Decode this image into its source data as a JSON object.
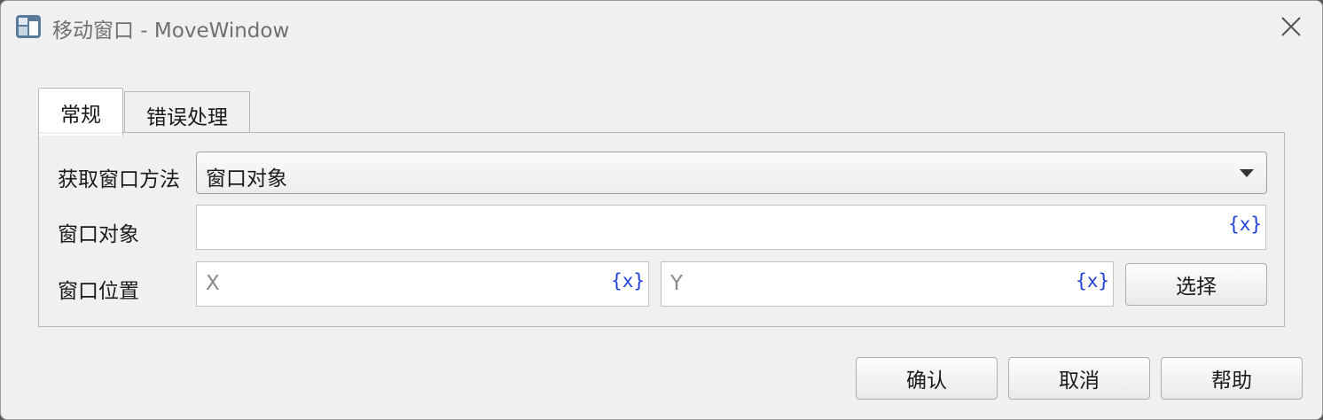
{
  "window": {
    "title": "移动窗口 - MoveWindow"
  },
  "tabs": [
    {
      "label": "常规",
      "active": true
    },
    {
      "label": "错误处理",
      "active": false
    }
  ],
  "form": {
    "method_label": "获取窗口方法",
    "method_value": "窗口对象",
    "object_label": "窗口对象",
    "object_value": "",
    "position_label": "窗口位置",
    "x_placeholder": "X",
    "y_placeholder": "Y",
    "var_token": "{x}",
    "pick_button": "选择"
  },
  "footer": {
    "ok": "确认",
    "cancel": "取消",
    "help": "帮助"
  },
  "icons": {
    "app": "app-icon",
    "close": "close-icon",
    "dropdown": "chevron-down-icon"
  }
}
